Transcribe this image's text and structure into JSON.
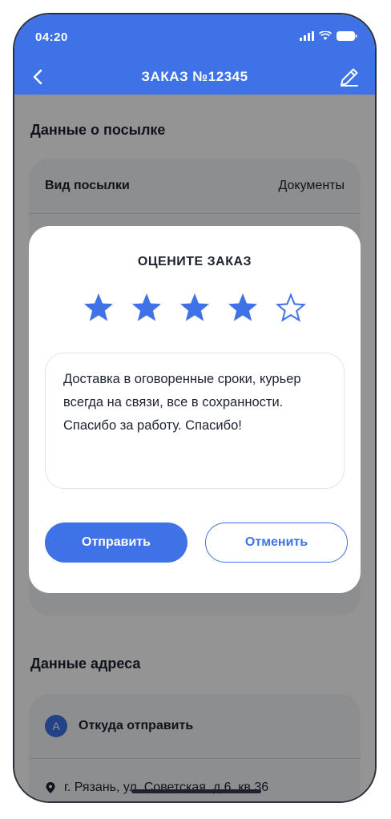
{
  "status_bar": {
    "time": "04:20"
  },
  "nav": {
    "title": "ЗАКАЗ №12345"
  },
  "parcel_section": {
    "title": "Данные о посылке",
    "rows": [
      {
        "label": "Вид посылки",
        "value": "Документы"
      }
    ]
  },
  "address_section": {
    "title": "Данные адреса",
    "from_badge": "A",
    "from_label": "Откуда отправить",
    "from_address": "г. Рязань, ул. Советская, д.6, кв.36"
  },
  "rating_dialog": {
    "title": "ОЦЕНИТЕ ЗАКАЗ",
    "rating": 4,
    "max_rating": 5,
    "comment": "Доставка в оговоренные сроки, курьер всегда на связи, все в сохранности. Спасибо за работу. Спасибо!",
    "submit_label": "Отправить",
    "cancel_label": "Отменить"
  },
  "colors": {
    "accent": "#3f72e6",
    "text": "#1c2230",
    "card": "#f3f4f7"
  }
}
